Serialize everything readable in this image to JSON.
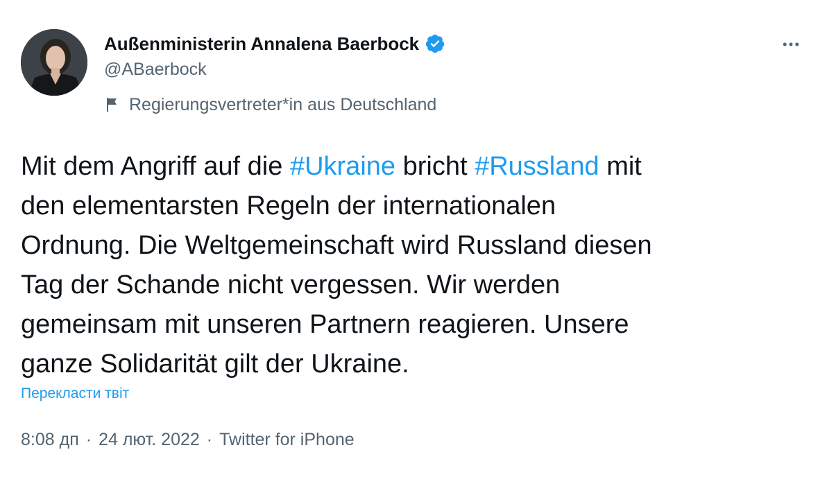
{
  "author": {
    "name": "Außenministerin Annalena Baerbock",
    "handle": "@ABaerbock",
    "label": "Regierungsvertreter*in aus Deutschland",
    "verified": true
  },
  "tweet": {
    "lines": [
      [
        {
          "text": "Mit dem Angriff auf die ",
          "type": "text"
        },
        {
          "text": "#Ukraine",
          "type": "hashtag"
        },
        {
          "text": " bricht ",
          "type": "text"
        },
        {
          "text": "#Russland",
          "type": "hashtag"
        },
        {
          "text": " mit",
          "type": "text"
        }
      ],
      [
        {
          "text": "den elementarsten Regeln der internationalen",
          "type": "text"
        }
      ],
      [
        {
          "text": "Ordnung. Die Weltgemeinschaft wird Russland diesen",
          "type": "text"
        }
      ],
      [
        {
          "text": "Tag der Schande nicht vergessen. Wir werden",
          "type": "text"
        }
      ],
      [
        {
          "text": "gemeinsam mit unseren Partnern reagieren. Unsere",
          "type": "text"
        }
      ],
      [
        {
          "text": "ganze Solidarität gilt der Ukraine.",
          "type": "text"
        }
      ]
    ],
    "translate_label": "Перекласти твіт"
  },
  "meta": {
    "time": "8:08 дп",
    "separator": "·",
    "date": "24 лют. 2022",
    "source": "Twitter for iPhone"
  },
  "icons": {
    "verified": "verified-badge-icon",
    "flag": "flag-icon",
    "more": "more-icon"
  },
  "colors": {
    "accent": "#1d9bf0",
    "text": "#0f1419",
    "secondary": "#536471"
  }
}
